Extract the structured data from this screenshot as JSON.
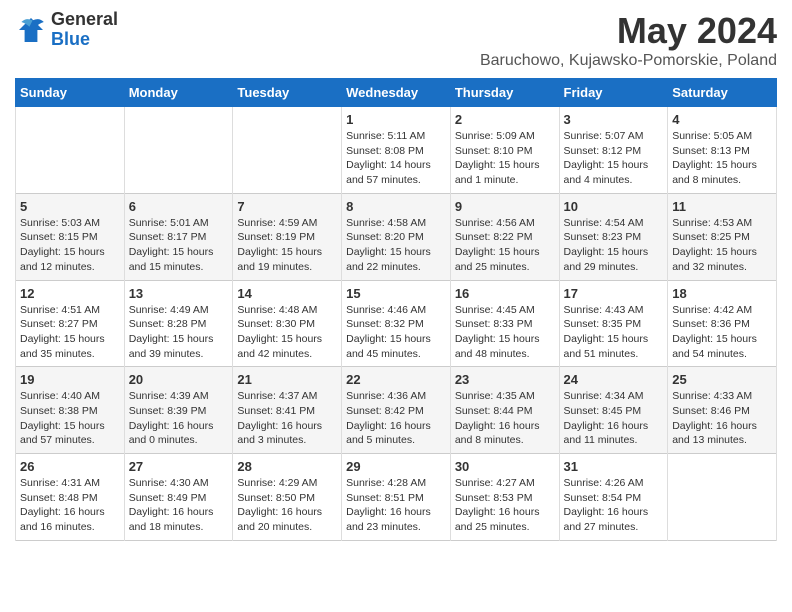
{
  "logo": {
    "general": "General",
    "blue": "Blue"
  },
  "title": {
    "month_year": "May 2024",
    "location": "Baruchowo, Kujawsko-Pomorskie, Poland"
  },
  "headers": [
    "Sunday",
    "Monday",
    "Tuesday",
    "Wednesday",
    "Thursday",
    "Friday",
    "Saturday"
  ],
  "weeks": [
    [
      {
        "day": "",
        "sunrise": "",
        "sunset": "",
        "daylight": ""
      },
      {
        "day": "",
        "sunrise": "",
        "sunset": "",
        "daylight": ""
      },
      {
        "day": "",
        "sunrise": "",
        "sunset": "",
        "daylight": ""
      },
      {
        "day": "1",
        "sunrise": "Sunrise: 5:11 AM",
        "sunset": "Sunset: 8:08 PM",
        "daylight": "Daylight: 14 hours and 57 minutes."
      },
      {
        "day": "2",
        "sunrise": "Sunrise: 5:09 AM",
        "sunset": "Sunset: 8:10 PM",
        "daylight": "Daylight: 15 hours and 1 minute."
      },
      {
        "day": "3",
        "sunrise": "Sunrise: 5:07 AM",
        "sunset": "Sunset: 8:12 PM",
        "daylight": "Daylight: 15 hours and 4 minutes."
      },
      {
        "day": "4",
        "sunrise": "Sunrise: 5:05 AM",
        "sunset": "Sunset: 8:13 PM",
        "daylight": "Daylight: 15 hours and 8 minutes."
      }
    ],
    [
      {
        "day": "5",
        "sunrise": "Sunrise: 5:03 AM",
        "sunset": "Sunset: 8:15 PM",
        "daylight": "Daylight: 15 hours and 12 minutes."
      },
      {
        "day": "6",
        "sunrise": "Sunrise: 5:01 AM",
        "sunset": "Sunset: 8:17 PM",
        "daylight": "Daylight: 15 hours and 15 minutes."
      },
      {
        "day": "7",
        "sunrise": "Sunrise: 4:59 AM",
        "sunset": "Sunset: 8:19 PM",
        "daylight": "Daylight: 15 hours and 19 minutes."
      },
      {
        "day": "8",
        "sunrise": "Sunrise: 4:58 AM",
        "sunset": "Sunset: 8:20 PM",
        "daylight": "Daylight: 15 hours and 22 minutes."
      },
      {
        "day": "9",
        "sunrise": "Sunrise: 4:56 AM",
        "sunset": "Sunset: 8:22 PM",
        "daylight": "Daylight: 15 hours and 25 minutes."
      },
      {
        "day": "10",
        "sunrise": "Sunrise: 4:54 AM",
        "sunset": "Sunset: 8:23 PM",
        "daylight": "Daylight: 15 hours and 29 minutes."
      },
      {
        "day": "11",
        "sunrise": "Sunrise: 4:53 AM",
        "sunset": "Sunset: 8:25 PM",
        "daylight": "Daylight: 15 hours and 32 minutes."
      }
    ],
    [
      {
        "day": "12",
        "sunrise": "Sunrise: 4:51 AM",
        "sunset": "Sunset: 8:27 PM",
        "daylight": "Daylight: 15 hours and 35 minutes."
      },
      {
        "day": "13",
        "sunrise": "Sunrise: 4:49 AM",
        "sunset": "Sunset: 8:28 PM",
        "daylight": "Daylight: 15 hours and 39 minutes."
      },
      {
        "day": "14",
        "sunrise": "Sunrise: 4:48 AM",
        "sunset": "Sunset: 8:30 PM",
        "daylight": "Daylight: 15 hours and 42 minutes."
      },
      {
        "day": "15",
        "sunrise": "Sunrise: 4:46 AM",
        "sunset": "Sunset: 8:32 PM",
        "daylight": "Daylight: 15 hours and 45 minutes."
      },
      {
        "day": "16",
        "sunrise": "Sunrise: 4:45 AM",
        "sunset": "Sunset: 8:33 PM",
        "daylight": "Daylight: 15 hours and 48 minutes."
      },
      {
        "day": "17",
        "sunrise": "Sunrise: 4:43 AM",
        "sunset": "Sunset: 8:35 PM",
        "daylight": "Daylight: 15 hours and 51 minutes."
      },
      {
        "day": "18",
        "sunrise": "Sunrise: 4:42 AM",
        "sunset": "Sunset: 8:36 PM",
        "daylight": "Daylight: 15 hours and 54 minutes."
      }
    ],
    [
      {
        "day": "19",
        "sunrise": "Sunrise: 4:40 AM",
        "sunset": "Sunset: 8:38 PM",
        "daylight": "Daylight: 15 hours and 57 minutes."
      },
      {
        "day": "20",
        "sunrise": "Sunrise: 4:39 AM",
        "sunset": "Sunset: 8:39 PM",
        "daylight": "Daylight: 16 hours and 0 minutes."
      },
      {
        "day": "21",
        "sunrise": "Sunrise: 4:37 AM",
        "sunset": "Sunset: 8:41 PM",
        "daylight": "Daylight: 16 hours and 3 minutes."
      },
      {
        "day": "22",
        "sunrise": "Sunrise: 4:36 AM",
        "sunset": "Sunset: 8:42 PM",
        "daylight": "Daylight: 16 hours and 5 minutes."
      },
      {
        "day": "23",
        "sunrise": "Sunrise: 4:35 AM",
        "sunset": "Sunset: 8:44 PM",
        "daylight": "Daylight: 16 hours and 8 minutes."
      },
      {
        "day": "24",
        "sunrise": "Sunrise: 4:34 AM",
        "sunset": "Sunset: 8:45 PM",
        "daylight": "Daylight: 16 hours and 11 minutes."
      },
      {
        "day": "25",
        "sunrise": "Sunrise: 4:33 AM",
        "sunset": "Sunset: 8:46 PM",
        "daylight": "Daylight: 16 hours and 13 minutes."
      }
    ],
    [
      {
        "day": "26",
        "sunrise": "Sunrise: 4:31 AM",
        "sunset": "Sunset: 8:48 PM",
        "daylight": "Daylight: 16 hours and 16 minutes."
      },
      {
        "day": "27",
        "sunrise": "Sunrise: 4:30 AM",
        "sunset": "Sunset: 8:49 PM",
        "daylight": "Daylight: 16 hours and 18 minutes."
      },
      {
        "day": "28",
        "sunrise": "Sunrise: 4:29 AM",
        "sunset": "Sunset: 8:50 PM",
        "daylight": "Daylight: 16 hours and 20 minutes."
      },
      {
        "day": "29",
        "sunrise": "Sunrise: 4:28 AM",
        "sunset": "Sunset: 8:51 PM",
        "daylight": "Daylight: 16 hours and 23 minutes."
      },
      {
        "day": "30",
        "sunrise": "Sunrise: 4:27 AM",
        "sunset": "Sunset: 8:53 PM",
        "daylight": "Daylight: 16 hours and 25 minutes."
      },
      {
        "day": "31",
        "sunrise": "Sunrise: 4:26 AM",
        "sunset": "Sunset: 8:54 PM",
        "daylight": "Daylight: 16 hours and 27 minutes."
      },
      {
        "day": "",
        "sunrise": "",
        "sunset": "",
        "daylight": ""
      }
    ]
  ]
}
